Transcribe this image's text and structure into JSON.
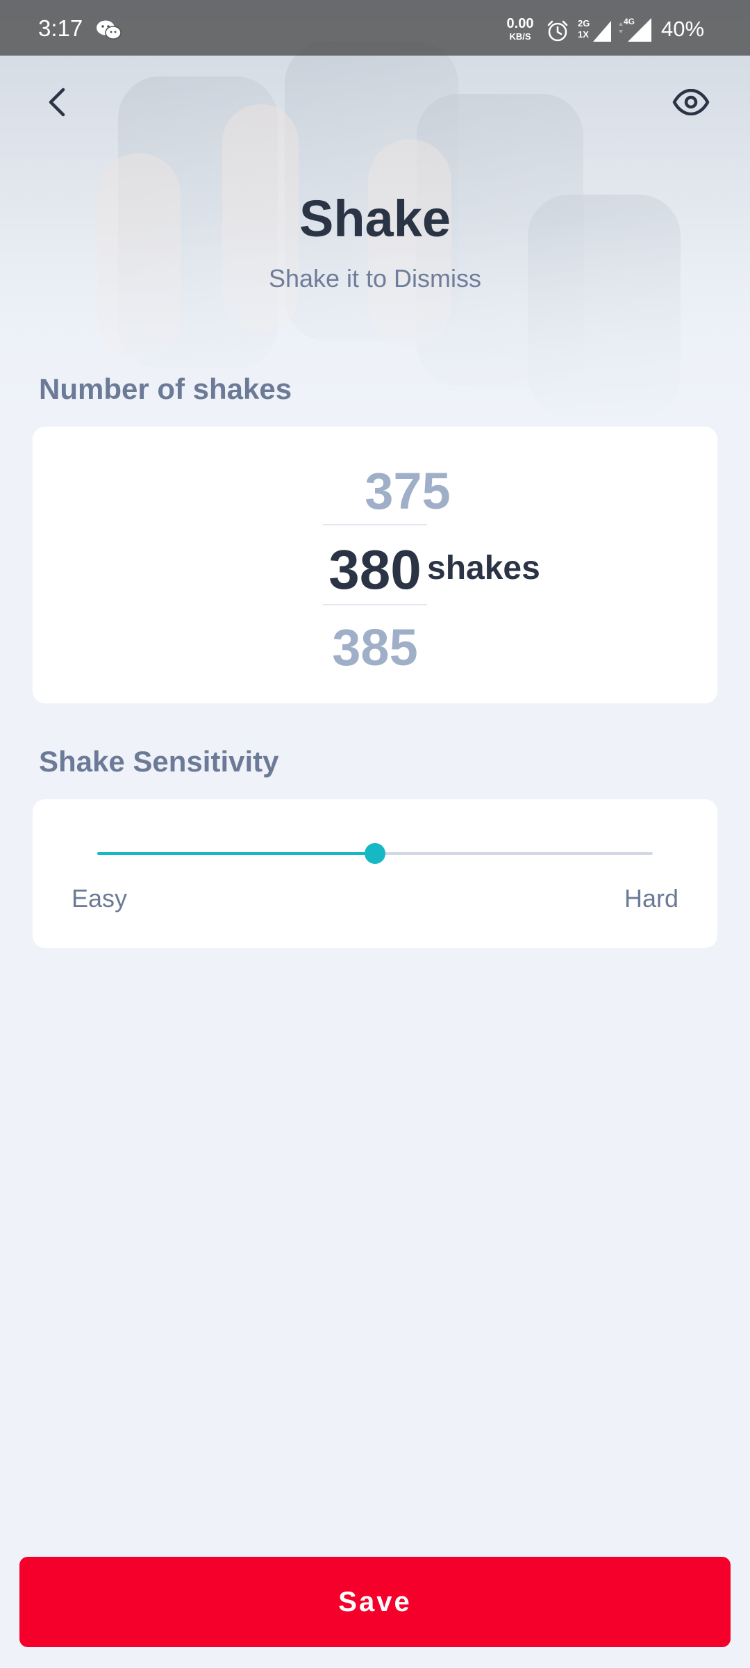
{
  "status_bar": {
    "time": "3:17",
    "net_speed_value": "0.00",
    "net_speed_unit": "KB/S",
    "signal_2g_top": "2G",
    "signal_2g_bottom": "1X",
    "signal_4g": "4G",
    "battery": "40%",
    "icons": [
      "wechat-icon",
      "alarm-icon",
      "signal-icon"
    ]
  },
  "header": {
    "back_icon": "chevron-left-icon",
    "preview_icon": "eye-icon",
    "title": "Shake",
    "subtitle": "Shake it to Dismiss"
  },
  "shakes": {
    "label": "Number of shakes",
    "above": "375",
    "selected": "380",
    "below": "385",
    "unit": "shakes"
  },
  "sensitivity": {
    "label": "Shake Sensitivity",
    "min_label": "Easy",
    "max_label": "Hard",
    "value_fraction": 0.5
  },
  "footer": {
    "save_label": "Save"
  },
  "colors": {
    "accent": "#16b8c4",
    "save_button": "#f5002a",
    "title_text": "#2b3445",
    "muted_text": "#6c7a97",
    "background": "#eff3f9"
  }
}
